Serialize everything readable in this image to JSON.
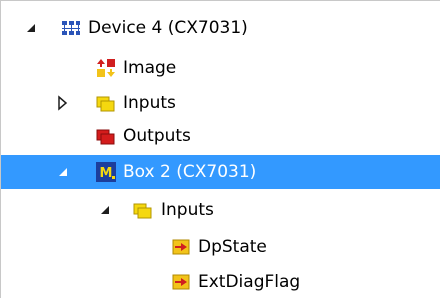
{
  "tree": [
    {
      "label": "Device 4 (CX7031)",
      "icon": "device-network-icon",
      "expander": "expanded",
      "selected": false
    },
    {
      "label": "Image",
      "icon": "image-icon",
      "expander": "none",
      "selected": false
    },
    {
      "label": "Inputs",
      "icon": "inputs-folder-icon",
      "expander": "collapsed",
      "selected": false
    },
    {
      "label": "Outputs",
      "icon": "outputs-folder-icon",
      "expander": "none",
      "selected": false
    },
    {
      "label": "Box 2 (CX7031)",
      "icon": "box-module-icon",
      "expander": "expanded",
      "selected": true
    },
    {
      "label": "Inputs",
      "icon": "inputs-folder-icon",
      "expander": "expanded",
      "selected": false
    },
    {
      "label": "DpState",
      "icon": "input-variable-icon",
      "expander": "none",
      "selected": false
    },
    {
      "label": "ExtDiagFlag",
      "icon": "input-variable-icon",
      "expander": "none",
      "selected": false
    }
  ],
  "colors": {
    "selection": "#3399ff",
    "folder_yellow": "#f5d80f",
    "outputs_red": "#d41c1c",
    "variable_yellow": "#f2c31a"
  }
}
